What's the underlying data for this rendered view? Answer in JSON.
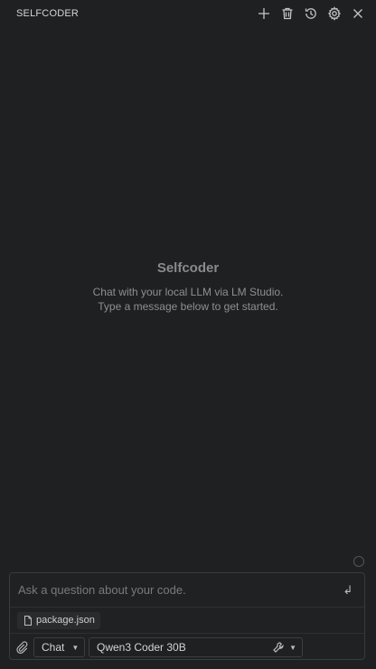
{
  "header": {
    "title": "SELFCODER",
    "actions": [
      "plus-icon",
      "trash-icon",
      "history-icon",
      "gear-icon",
      "close-icon"
    ]
  },
  "empty_state": {
    "title": "Selfcoder",
    "line1": "Chat with your local LLM via LM Studio.",
    "line2": "Type a message below to get started."
  },
  "composer": {
    "placeholder": "Ask a question about your code.",
    "send_icon": "enter-icon",
    "context_file": "package.json",
    "mode": "Chat",
    "model": "Qwen3 Coder 30B"
  }
}
